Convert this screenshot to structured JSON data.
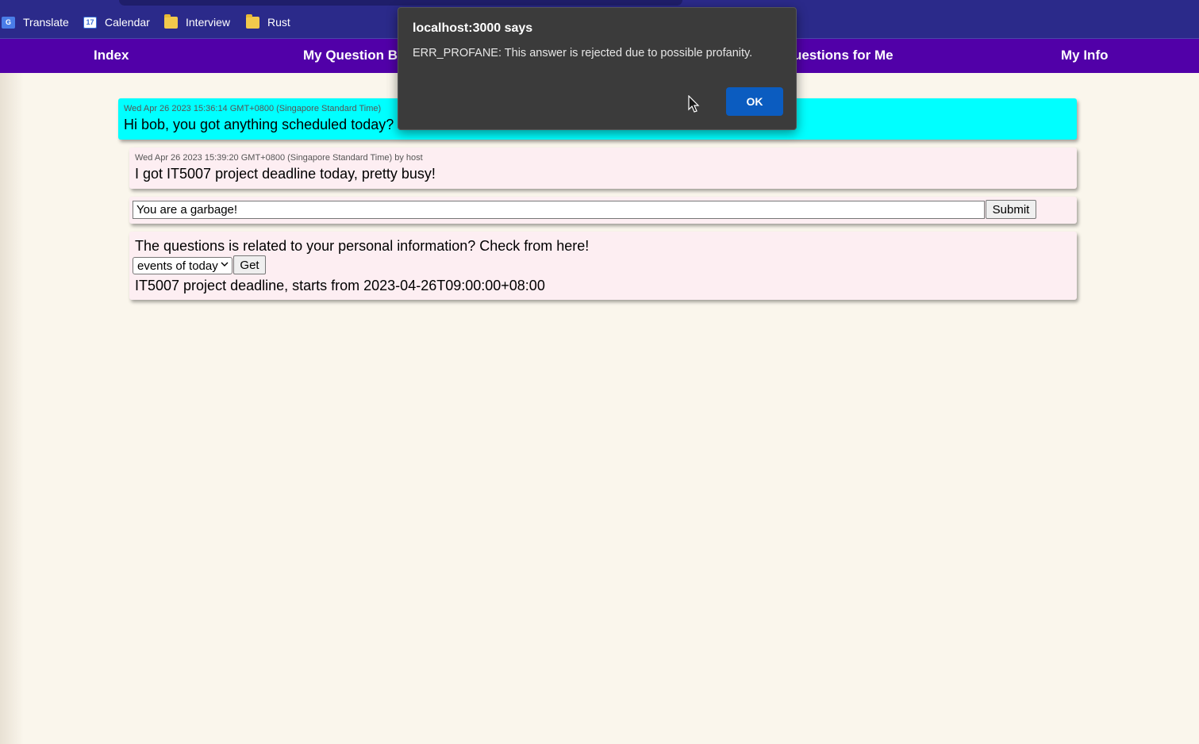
{
  "bookmarks": [
    {
      "label": "Translate",
      "icon": "google-translate-icon"
    },
    {
      "label": "Calendar",
      "icon": "calendar-icon",
      "glyph": "17"
    },
    {
      "label": "Interview",
      "icon": "folder-icon"
    },
    {
      "label": "Rust",
      "icon": "folder-icon"
    }
  ],
  "translate_glyph": "G",
  "nav": {
    "index": "Index",
    "my_question_box": "My Question Bo",
    "questions_for_me": "uestions for Me",
    "my_info": "My Info"
  },
  "question": {
    "timestamp": "Wed Apr 26 2023 15:36:14 GMT+0800 (Singapore Standard Time)",
    "text": "Hi bob, you got anything scheduled today?"
  },
  "answer": {
    "timestamp": "Wed Apr 26 2023 15:39:20 GMT+0800 (Singapore Standard Time) by host",
    "text": "I got IT5007 project deadline today, pretty busy!"
  },
  "answer_form": {
    "input_value": "You are a garbage!",
    "submit_label": "Submit"
  },
  "personal_info": {
    "prompt": "The questions is related to your personal information? Check from here!",
    "selected_option": "events of today",
    "get_label": "Get",
    "result": "IT5007 project deadline, starts from 2023-04-26T09:00:00+08:00"
  },
  "dialog": {
    "title": "localhost:3000 says",
    "message": "ERR_PROFANE: This answer is rejected due to possible profanity.",
    "ok_label": "OK"
  },
  "colors": {
    "nav_bg": "#5100a8",
    "bookmarks_bg": "#2b2a8a",
    "question_bg": "#00ffff",
    "answer_bg": "#fdeef2",
    "page_bg": "#faf6ec",
    "dialog_bg": "#3b3b3b",
    "ok_button": "#0b5cc0"
  }
}
